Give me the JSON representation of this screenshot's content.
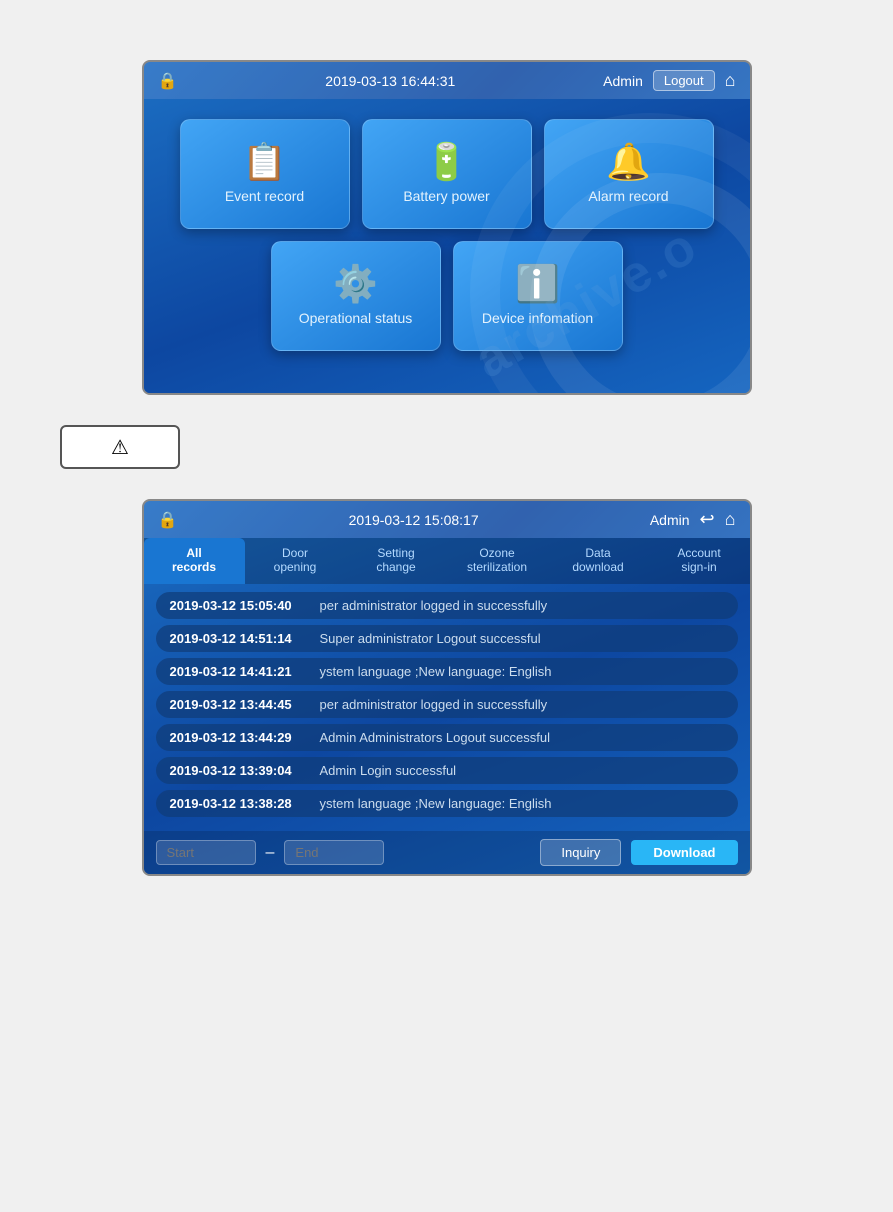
{
  "screen1": {
    "header": {
      "datetime": "2019-03-13 16:44:31",
      "user": "Admin",
      "logout_label": "Logout"
    },
    "cards": [
      {
        "id": "event-record",
        "label": "Event record",
        "icon": "📋"
      },
      {
        "id": "battery-power",
        "label": "Battery power",
        "icon": "🔋"
      },
      {
        "id": "alarm-record",
        "label": "Alarm record",
        "icon": "🔔"
      },
      {
        "id": "operational-status",
        "label": "Operational status",
        "icon": "⚙️"
      },
      {
        "id": "device-information",
        "label": "Device infomation",
        "icon": "ℹ️"
      }
    ]
  },
  "warning_box": {
    "icon": "⚠"
  },
  "screen2": {
    "header": {
      "datetime": "2019-03-12 15:08:17",
      "user": "Admin"
    },
    "tabs": [
      {
        "id": "all-records",
        "label": "All\nrecords",
        "active": true
      },
      {
        "id": "door-opening",
        "label": "Door\nopening",
        "active": false
      },
      {
        "id": "setting-change",
        "label": "Setting\nchange",
        "active": false
      },
      {
        "id": "ozone-sterilization",
        "label": "Ozone\nsterilization",
        "active": false
      },
      {
        "id": "data-download",
        "label": "Data\ndownload",
        "active": false
      },
      {
        "id": "account-sign-in",
        "label": "Account\nsign-in",
        "active": false
      }
    ],
    "records": [
      {
        "time": "2019-03-12 15:05:40",
        "desc": "per administrator logged in successfully"
      },
      {
        "time": "2019-03-12 14:51:14",
        "desc": "Super administrator Logout successful"
      },
      {
        "time": "2019-03-12 14:41:21",
        "desc": "ystem language ;New language: English"
      },
      {
        "time": "2019-03-12 13:44:45",
        "desc": "per administrator logged in successfully"
      },
      {
        "time": "2019-03-12 13:44:29",
        "desc": "Admin Administrators Logout successful"
      },
      {
        "time": "2019-03-12 13:39:04",
        "desc": "Admin Login successful"
      },
      {
        "time": "2019-03-12 13:38:28",
        "desc": "ystem language ;New language: English"
      }
    ],
    "bottom": {
      "start_label": "Start",
      "end_label": "End",
      "dash": "–",
      "inquiry_label": "Inquiry",
      "download_label": "Download"
    }
  }
}
